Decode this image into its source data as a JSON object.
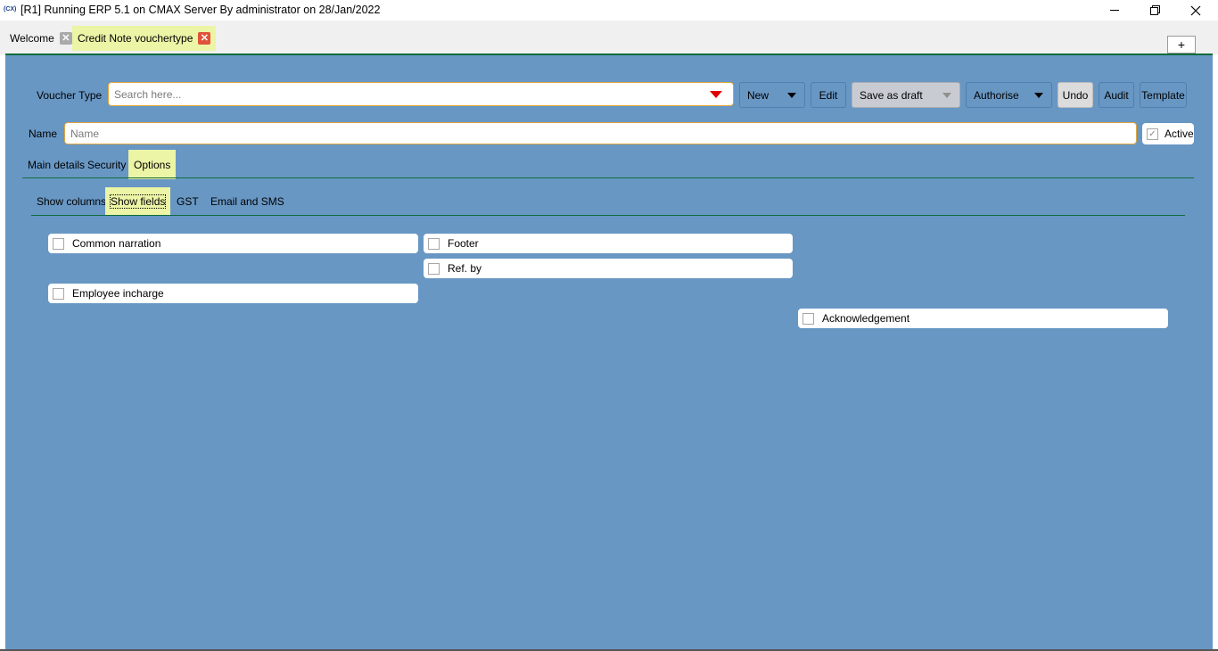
{
  "window": {
    "title": "[R1] Running ERP 5.1 on CMAX Server By administrator on 28/Jan/2022",
    "app_icon_text": "(CX)"
  },
  "tabs": {
    "items": [
      {
        "label": "Welcome"
      },
      {
        "label": "Credit Note vouchertype"
      }
    ],
    "add_label": "+"
  },
  "toolbar": {
    "voucher_type_label": "Voucher Type",
    "search_placeholder": "Search here...",
    "search_value": "",
    "new_label": "New",
    "edit_label": "Edit",
    "save_draft_label": "Save as draft",
    "authorise_label": "Authorise",
    "undo_label": "Undo",
    "audit_label": "Audit",
    "template_label": "Template"
  },
  "form": {
    "name_label": "Name",
    "name_placeholder": "Name",
    "name_value": "",
    "active_label": "Active",
    "active_checked": true
  },
  "section_tabs": {
    "items": [
      {
        "label": "Main details"
      },
      {
        "label": "Security"
      },
      {
        "label": "Options"
      }
    ],
    "selected": "Options"
  },
  "option_tabs": {
    "items": [
      {
        "label": "Show columns"
      },
      {
        "label": "Show fields"
      },
      {
        "label": "GST"
      },
      {
        "label": "Email and SMS"
      }
    ],
    "selected": "Show fields"
  },
  "fields": {
    "common_narration": {
      "label": "Common narration",
      "checked": false
    },
    "footer": {
      "label": "Footer",
      "checked": false
    },
    "ref_by": {
      "label": "Ref. by",
      "checked": false
    },
    "employee_incharge": {
      "label": "Employee incharge",
      "checked": false
    },
    "acknowledgement": {
      "label": "Acknowledgement",
      "checked": false
    }
  },
  "colors": {
    "panel_bg": "#6897c4",
    "highlight": "#ecf4a6",
    "divider": "#0e6b3a",
    "accent_border": "#e0a53d",
    "caret": "#e00000"
  }
}
